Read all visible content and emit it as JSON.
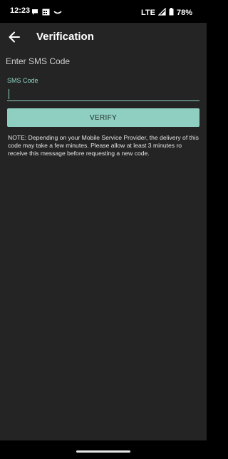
{
  "status_bar": {
    "time": "12:23",
    "network": "LTE",
    "battery": "78%",
    "left_icons": [
      "chat-bubble-icon",
      "calendar-grid-icon",
      "amazon-smile-icon"
    ],
    "right_icons": [
      "signal-icon",
      "battery-icon"
    ]
  },
  "app_bar": {
    "title": "Verification",
    "back_icon": "arrow-left-icon"
  },
  "form": {
    "heading": "Enter SMS Code",
    "sms_label": "SMS Code",
    "sms_value": "",
    "verify_label": "VERIFY",
    "note": "NOTE: Depending on your Mobile Service Provider, the delivery of this code may take a few minutes. Please allow at least 3 minutes ro receive this message before requesting a new code."
  },
  "colors": {
    "background": "#242424",
    "accent": "#8fd6c6",
    "button": "#8fcfc1",
    "status_bar": "#000000"
  }
}
